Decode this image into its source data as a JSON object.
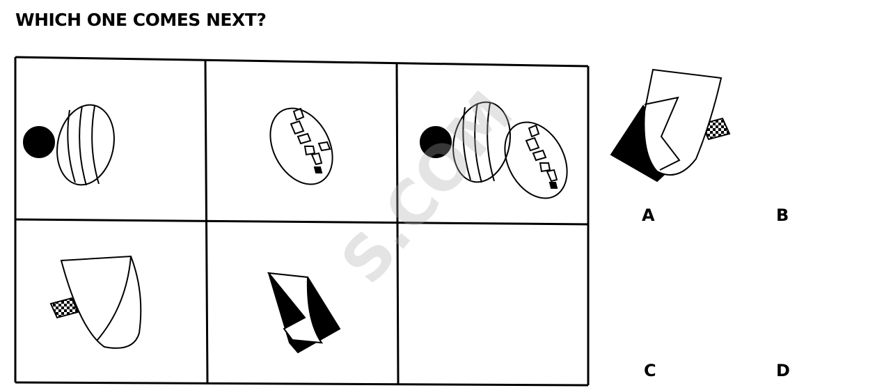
{
  "title": "WHICH ONE COMES NEXT?",
  "grid": {
    "rows": 2,
    "cols": 3,
    "cells": [
      {
        "row": 1,
        "col": 1,
        "content": "circle-and-striped-oval"
      },
      {
        "row": 1,
        "col": 2,
        "content": "oval-with-blocks"
      },
      {
        "row": 1,
        "col": 3,
        "content": "combined-circle-striped-oval-and-oval-with-blocks"
      },
      {
        "row": 2,
        "col": 1,
        "content": "curved-shape-with-checkered-flag"
      },
      {
        "row": 2,
        "col": 2,
        "content": "zigzag-shape-with-black-fill"
      },
      {
        "row": 2,
        "col": 3,
        "content": "empty"
      }
    ]
  },
  "options": [
    {
      "label": "A",
      "icon": "option-a-figure"
    },
    {
      "label": "B",
      "icon": "option-b-figure"
    },
    {
      "label": "C",
      "icon": "option-c-figure"
    },
    {
      "label": "D",
      "icon": "option-d-figure"
    }
  ],
  "watermark": "S.COM",
  "colors": {
    "ink": "#000000",
    "background": "#ffffff",
    "watermark": "#aaaaaa"
  }
}
